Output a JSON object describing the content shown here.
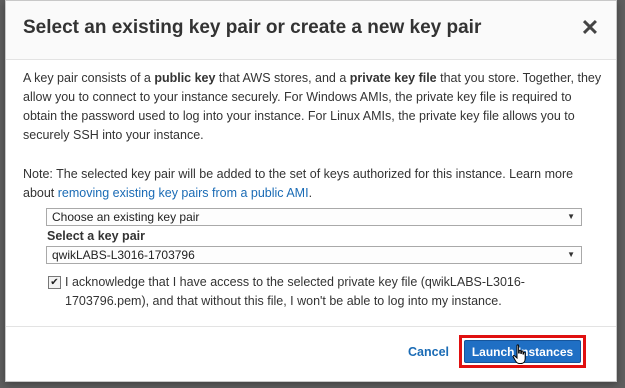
{
  "dialog": {
    "title": "Select an existing key pair or create a new key pair",
    "close_glyph": "✕"
  },
  "body": {
    "desc_prefix": "A key pair consists of a ",
    "desc_bold1": "public key",
    "desc_mid1": " that AWS stores, and a ",
    "desc_bold2": "private key file",
    "desc_rest": " that you store. Together, they allow you to connect to your instance securely. For Windows AMIs, the private key file is required to obtain the password used to log into your instance. For Linux AMIs, the private key file allows you to securely SSH into your instance.",
    "note_text": "Note: The selected key pair will be added to the set of keys authorized for this instance. Learn more about ",
    "note_link": "removing existing key pairs from a public AMI",
    "note_end": "."
  },
  "form": {
    "keypair_action": "Choose an existing key pair",
    "select_label": "Select a key pair",
    "keypair_value": "qwikLABS-L3016-1703796",
    "arrow_glyph": "▼",
    "ack_checked": true,
    "ack_check_glyph": "✔",
    "ack_text": "I acknowledge that I have access to the selected private key file (qwikLABS-L3016-1703796.pem), and that without this file, I won't be able to log into my instance."
  },
  "footer": {
    "cancel_label": "Cancel",
    "launch_label": "Launch Instances"
  },
  "colors": {
    "link": "#1a6bb5",
    "primary_button": "#1f6fc4",
    "highlight_outline": "#e01010"
  }
}
